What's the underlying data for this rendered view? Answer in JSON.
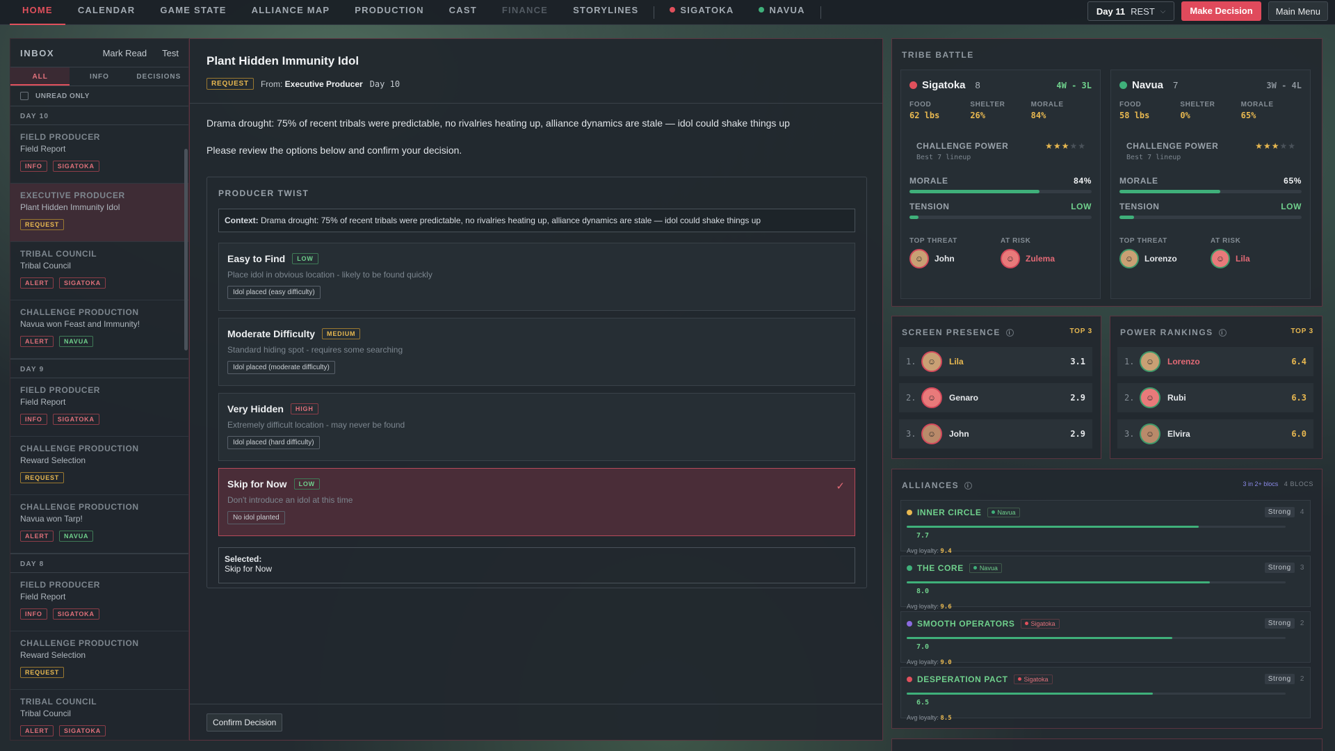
{
  "nav": {
    "tabs": [
      "HOME",
      "CALENDAR",
      "GAME STATE",
      "ALLIANCE MAP",
      "PRODUCTION",
      "CAST",
      "FINANCE",
      "STORYLINES"
    ],
    "active_tab": "HOME",
    "tribe_tabs": [
      {
        "label": "SIGATOKA",
        "color": "#e0505c"
      },
      {
        "label": "NAVUA",
        "color": "#3fb07a"
      }
    ],
    "day": "Day 11",
    "phase": "REST",
    "make_decision": "Make Decision",
    "main_menu": "Main Menu"
  },
  "inbox": {
    "title": "INBOX",
    "mark_read": "Mark Read",
    "test": "Test",
    "tabs": [
      "ALL",
      "INFO",
      "DECISIONS"
    ],
    "unread_only": "UNREAD ONLY",
    "groups": [
      {
        "day": "DAY 10",
        "messages": [
          {
            "from": "FIELD PRODUCER",
            "subject": "Field Report",
            "tags": [
              "INFO",
              "SIGATOKA"
            ]
          },
          {
            "from": "EXECUTIVE PRODUCER",
            "subject": "Plant Hidden Immunity Idol",
            "tags": [
              "REQUEST"
            ]
          },
          {
            "from": "TRIBAL COUNCIL",
            "subject": "Tribal Council",
            "tags": [
              "ALERT",
              "SIGATOKA"
            ]
          },
          {
            "from": "CHALLENGE PRODUCTION",
            "subject": "Navua won Feast and Immunity!",
            "tags": [
              "ALERT",
              "NAVUA"
            ]
          }
        ]
      },
      {
        "day": "DAY 9",
        "messages": [
          {
            "from": "FIELD PRODUCER",
            "subject": "Field Report",
            "tags": [
              "INFO",
              "SIGATOKA"
            ]
          },
          {
            "from": "CHALLENGE PRODUCTION",
            "subject": "Reward Selection",
            "tags": [
              "REQUEST"
            ]
          },
          {
            "from": "CHALLENGE PRODUCTION",
            "subject": "Navua won Tarp!",
            "tags": [
              "ALERT",
              "NAVUA"
            ]
          }
        ]
      },
      {
        "day": "DAY 8",
        "messages": [
          {
            "from": "FIELD PRODUCER",
            "subject": "Field Report",
            "tags": [
              "INFO",
              "SIGATOKA"
            ]
          },
          {
            "from": "CHALLENGE PRODUCTION",
            "subject": "Reward Selection",
            "tags": [
              "REQUEST"
            ]
          },
          {
            "from": "TRIBAL COUNCIL",
            "subject": "Tribal Council",
            "tags": [
              "ALERT",
              "SIGATOKA"
            ]
          }
        ]
      }
    ]
  },
  "detail": {
    "title": "Plant Hidden Immunity Idol",
    "tag": "REQUEST",
    "from_label": "From:",
    "from": "Executive Producer",
    "day": "Day 10",
    "body1": "Drama drought: 75% of recent tribals were predictable, no rivalries heating up, alliance dynamics are stale — idol could shake things up",
    "body2": "Please review the options below and confirm your decision.",
    "twist_title": "PRODUCER TWIST",
    "context_label": "Context:",
    "context": "Drama drought: 75% of recent tribals were predictable, no rivalries heating up, alliance dynamics are stale — idol could shake things up",
    "options": [
      {
        "name": "Easy to Find",
        "level": "LOW",
        "desc": "Place idol in obvious location - likely to be found quickly",
        "result": "Idol placed (easy difficulty)"
      },
      {
        "name": "Moderate Difficulty",
        "level": "MEDIUM",
        "desc": "Standard hiding spot - requires some searching",
        "result": "Idol placed (moderate difficulty)"
      },
      {
        "name": "Very Hidden",
        "level": "HIGH",
        "desc": "Extremely difficult location - may never be found",
        "result": "Idol placed (hard difficulty)"
      },
      {
        "name": "Skip for Now",
        "level": "LOW",
        "desc": "Don't introduce an idol at this time",
        "result": "No idol planted"
      }
    ],
    "selected_label": "Selected:",
    "selected_value": "Skip for Now",
    "confirm": "Confirm Decision"
  },
  "tribe_battle": {
    "title": "TRIBE BATTLE",
    "tribes": [
      {
        "name": "Sigatoka",
        "color": "#e0505c",
        "count": "8",
        "record": "4W - 3L",
        "food": "62 lbs",
        "shelter": "26%",
        "morale": "84%",
        "stars": 3,
        "morale_pct": 84,
        "tension": "LOW",
        "tension_pct": 5,
        "top_threat": "John",
        "at_risk": "Zulema"
      },
      {
        "name": "Navua",
        "color": "#3fb07a",
        "count": "7",
        "record": "3W - 4L",
        "food": "58 lbs",
        "shelter": "0%",
        "morale": "65%",
        "stars": 3,
        "morale_pct": 65,
        "tension": "LOW",
        "tension_pct": 8,
        "top_threat": "Lorenzo",
        "at_risk": "Lila"
      }
    ],
    "labels": {
      "food": "FOOD",
      "shelter": "SHELTER",
      "morale": "MORALE",
      "challenge_power": "CHALLENGE POWER",
      "best_lineup": "Best 7 lineup",
      "morale_bar": "MORALE",
      "tension": "TENSION",
      "top_threat": "TOP THREAT",
      "at_risk": "AT RISK"
    }
  },
  "screen_presence": {
    "title": "SCREEN PRESENCE",
    "badge": "TOP 3",
    "rows": [
      {
        "rank": "1.",
        "name": "Lila",
        "score": "3.1"
      },
      {
        "rank": "2.",
        "name": "Genaro",
        "score": "2.9"
      },
      {
        "rank": "3.",
        "name": "John",
        "score": "2.9"
      }
    ]
  },
  "power_rankings": {
    "title": "POWER RANKINGS",
    "badge": "TOP 3",
    "rows": [
      {
        "rank": "1.",
        "name": "Lorenzo",
        "score": "6.4"
      },
      {
        "rank": "2.",
        "name": "Rubi",
        "score": "6.3"
      },
      {
        "rank": "3.",
        "name": "Elvira",
        "score": "6.0"
      }
    ]
  },
  "alliances": {
    "title": "ALLIANCES",
    "summary": "3 in 2+ blocs",
    "blocs": "4 BLOCS",
    "avg_loyalty_label": "Avg loyalty:",
    "items": [
      {
        "name": "INNER CIRCLE",
        "tribe": "Navua",
        "strength": "Strong",
        "count": "4",
        "score": "7.7",
        "pct": 77,
        "loyalty": "9.4",
        "color": "#e8b850"
      },
      {
        "name": "THE CORE",
        "tribe": "Navua",
        "strength": "Strong",
        "count": "3",
        "score": "8.0",
        "pct": 80,
        "loyalty": "9.6",
        "color": "#3fb07a"
      },
      {
        "name": "SMOOTH OPERATORS",
        "tribe": "Sigatoka",
        "strength": "Strong",
        "count": "2",
        "score": "7.0",
        "pct": 70,
        "loyalty": "9.0",
        "color": "#8b6ae0"
      },
      {
        "name": "DESPERATION PACT",
        "tribe": "Sigatoka",
        "strength": "Strong",
        "count": "2",
        "score": "6.5",
        "pct": 65,
        "loyalty": "8.5",
        "color": "#e0505c"
      }
    ]
  }
}
